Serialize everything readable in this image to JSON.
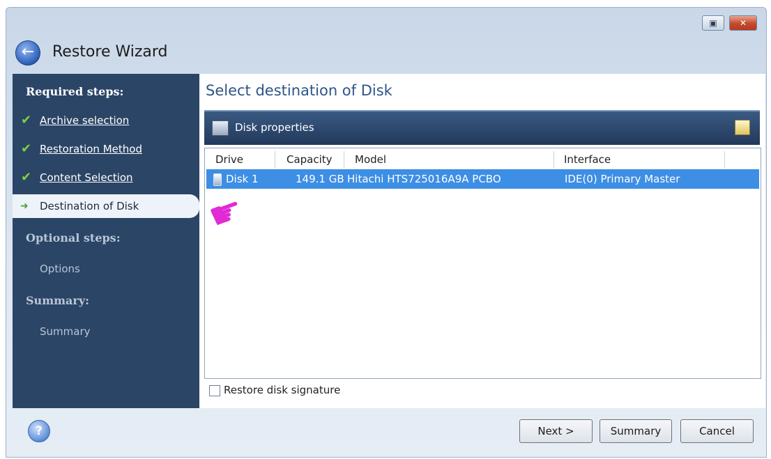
{
  "window": {
    "title": "Restore Wizard",
    "restore_glyph": "▣",
    "close_glyph": "✕",
    "back_glyph": "←"
  },
  "sidebar": {
    "required_heading": "Required steps:",
    "steps": [
      {
        "label": "Archive selection",
        "done": true
      },
      {
        "label": "Restoration Method",
        "done": true
      },
      {
        "label": "Content Selection",
        "done": true
      },
      {
        "label": "Destination of Disk",
        "active": true
      }
    ],
    "optional_heading": "Optional steps:",
    "optional_items": [
      "Options"
    ],
    "summary_heading": "Summary:",
    "summary_items": [
      "Summary"
    ],
    "check_glyph": "✔",
    "arrow_glyph": "➜"
  },
  "main": {
    "title": "Select destination of Disk",
    "panel_label": "Disk properties",
    "columns": [
      "Drive",
      "Capacity",
      "Model",
      "Interface"
    ],
    "rows": [
      {
        "drive": "Disk 1",
        "capacity": "149.1 GB",
        "model": "Hitachi HTS725016A9A PCBO",
        "interface": "IDE(0) Primary Master"
      }
    ],
    "pointer_glyph": "☛",
    "restore_signature_label": "Restore disk signature"
  },
  "footer": {
    "help_glyph": "?",
    "next_label": "Next >",
    "summary_label": "Summary",
    "cancel_label": "Cancel"
  },
  "colors": {
    "sidebar": "#2b4566",
    "selection": "#3d8ee5",
    "pointer": "#e02ad6"
  }
}
